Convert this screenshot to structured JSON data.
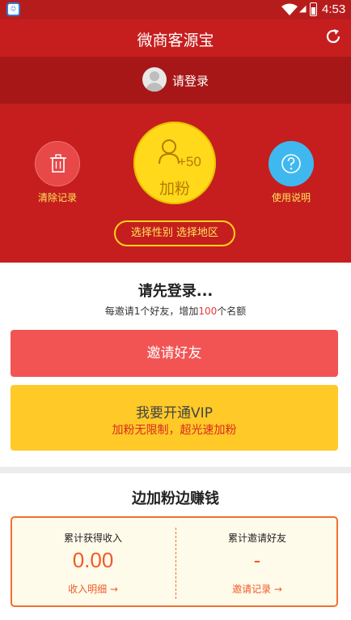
{
  "statusbar": {
    "time": "4:53",
    "notif_icon": "app-notification-icon"
  },
  "appbar": {
    "title": "微商客源宝",
    "refresh_icon": "refresh-icon"
  },
  "login": {
    "label": "请登录"
  },
  "hero": {
    "clear_label": "清除记录",
    "help_label": "使用说明",
    "fans_label": "加粉",
    "fans_bonus": "+50",
    "filter_label": "选择性别 选择地区"
  },
  "login_prompt": {
    "title": "请先登录...",
    "sub_prefix": "每邀请1个好友，增加",
    "sub_number": "100",
    "sub_suffix": "个名额"
  },
  "invite_button": "邀请好友",
  "vip": {
    "title": "我要开通VIP",
    "subtitle": "加粉无限制，超光速加粉"
  },
  "earn": {
    "title": "边加粉边赚钱",
    "income_label": "累计获得收入",
    "income_value": "0.00",
    "income_link": "收入明细 →",
    "friends_label": "累计邀请好友",
    "friends_value": "-",
    "friends_link": "邀请记录 →"
  },
  "colors": {
    "primary_red": "#c61e1e",
    "accent_yellow": "#ffd91a",
    "orange": "#f05a28"
  }
}
